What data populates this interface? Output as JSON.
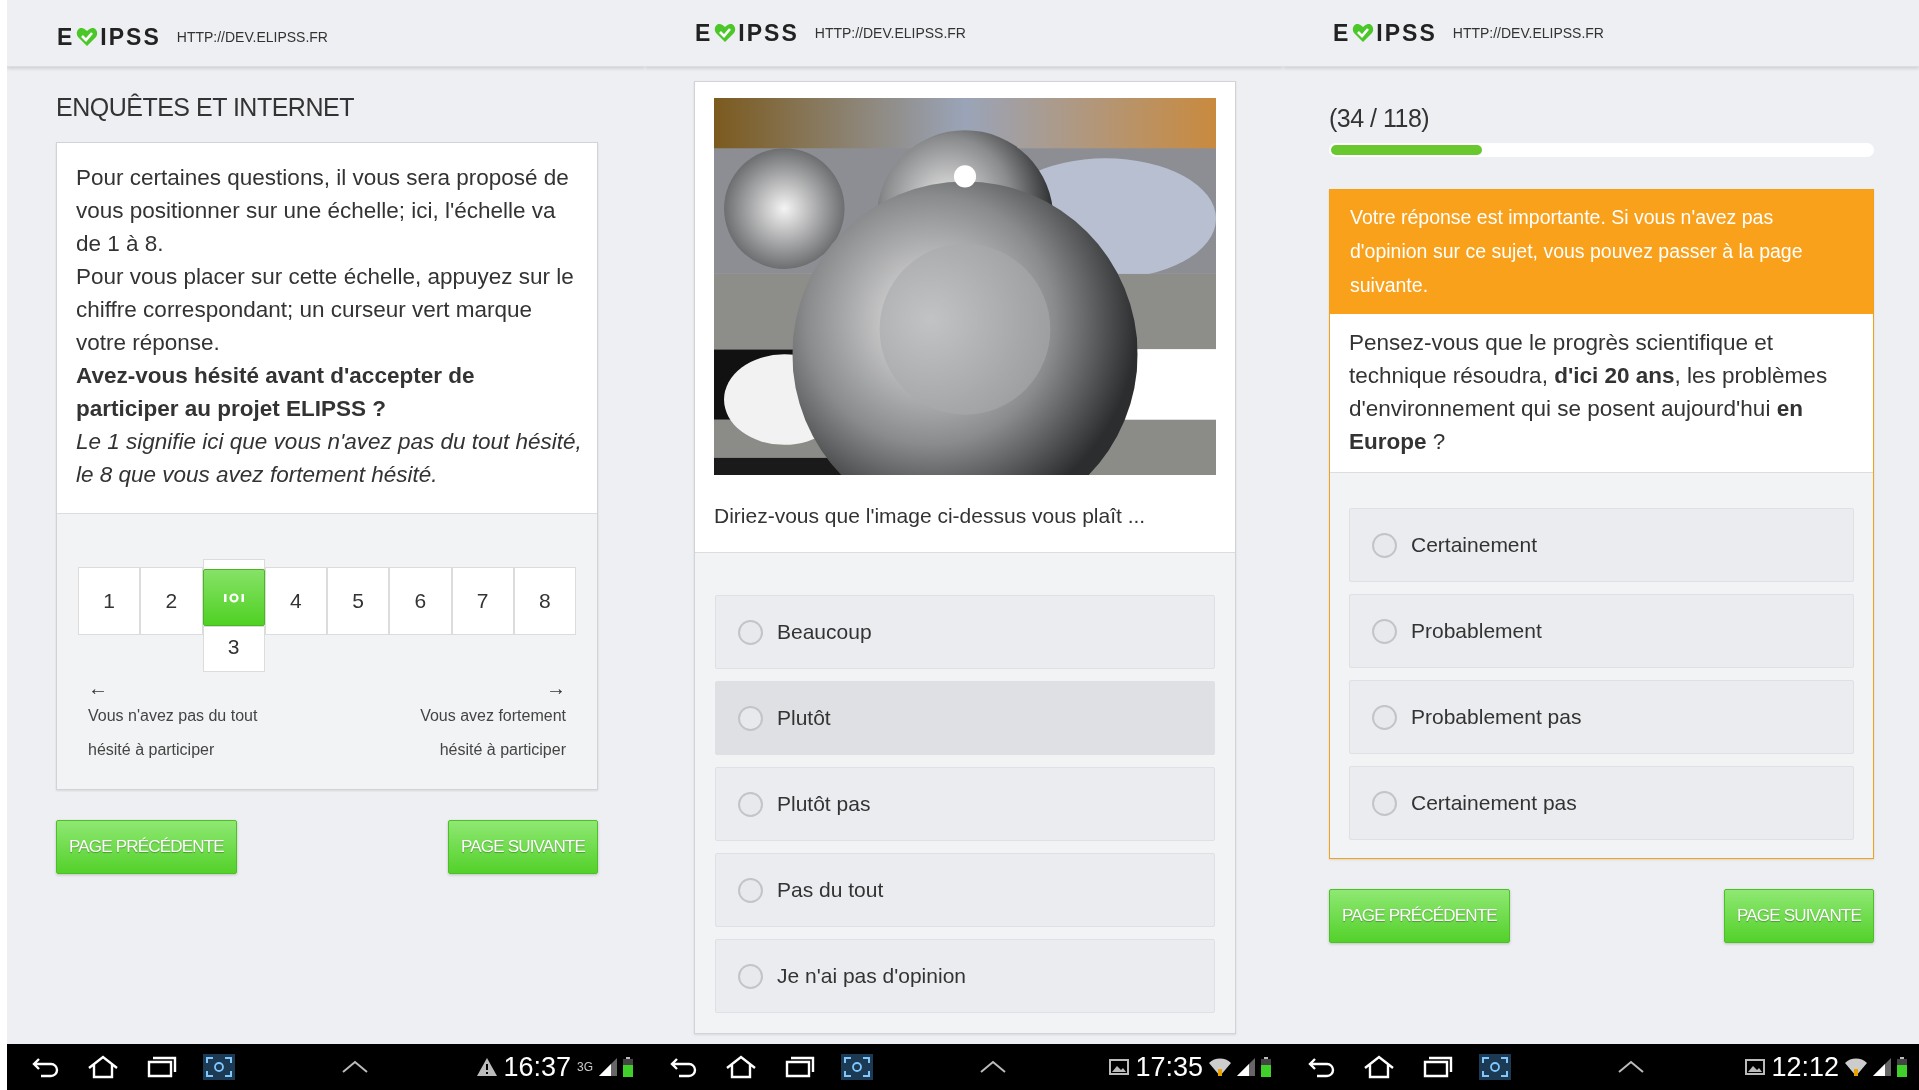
{
  "screens": [
    {
      "kind": "scale",
      "header": {
        "logo_left": "E",
        "logo_right": "IPSS",
        "url": "HTTP://DEV.ELIPSS.FR"
      },
      "title": "ENQUÊTES ET INTERNET",
      "paragraphs": [
        {
          "kind": "plain",
          "text": "Pour certaines questions, il vous sera proposé de vous positionner sur une échelle; ici, l'échelle va de 1 à 8."
        },
        {
          "kind": "plain",
          "text": "Pour vous placer sur cette échelle, appuyez sur le chiffre correspondant; un curseur vert marque votre réponse."
        },
        {
          "kind": "bold",
          "text": "Avez-vous hésité avant d'accepter de participer au projet ELIPSS ?"
        },
        {
          "kind": "italic",
          "text": "Le 1 signifie ici que vous n'avez pas du tout hésité, le 8 que vous avez fortement hésité."
        }
      ],
      "scale": {
        "steps": [
          {
            "label": "1",
            "selected": false
          },
          {
            "label": "2",
            "selected": false
          },
          {
            "label": "3",
            "selected": true
          },
          {
            "label": "4",
            "selected": false
          },
          {
            "label": "5",
            "selected": false
          },
          {
            "label": "6",
            "selected": false
          },
          {
            "label": "7",
            "selected": false
          },
          {
            "label": "8",
            "selected": false
          }
        ],
        "left_arrow": "←",
        "left_label": "Vous n'avez pas du tout hésité à participer",
        "right_arrow": "→",
        "right_label": "Vous avez fortement hésité à participer"
      },
      "buttons": [
        "PAGE PRÉCÉDENTE",
        "PAGE SUIVANTE"
      ],
      "status_bar": {
        "alert_icon": true,
        "picture_icon": false,
        "time": "16:37",
        "wifi": false,
        "network": "3G"
      }
    },
    {
      "kind": "image_question",
      "header": {
        "logo_left": "E",
        "logo_right": "IPSS",
        "url": "HTTP://DEV.ELIPSS.FR"
      },
      "question": "Diriez-vous que l'image ci-dessus vous plaît ...",
      "options": [
        {
          "label": "Beaucoup",
          "selected": false,
          "highlighted": false
        },
        {
          "label": "Plutôt",
          "selected": false,
          "highlighted": true
        },
        {
          "label": "Plutôt pas",
          "selected": false,
          "highlighted": false
        },
        {
          "label": "Pas du tout",
          "selected": false,
          "highlighted": false
        },
        {
          "label": "Je n'ai pas d'opinion",
          "selected": false,
          "highlighted": false
        }
      ],
      "status_bar": {
        "alert_icon": false,
        "picture_icon": true,
        "time": "17:35",
        "wifi": true
      }
    },
    {
      "kind": "choice_question",
      "header": {
        "logo_left": "E",
        "logo_right": "IPSS",
        "url": "HTTP://DEV.ELIPSS.FR"
      },
      "progress": {
        "text": "(34 / 118)",
        "level": 0.28
      },
      "notice": "Votre réponse est importante. Si vous n'avez pas d'opinion sur ce sujet, vous pouvez passer à la page suivante.",
      "question": "Pensez-vous que le progrès scientifique et technique résoudra, **d'ici 20 ans**, les problèmes d'environnement qui se posent aujourd'hui **en Europe** ?",
      "options": [
        {
          "label": "Certainement",
          "selected": false,
          "highlighted": false
        },
        {
          "label": "Probablement",
          "selected": false,
          "highlighted": false
        },
        {
          "label": "Probablement pas",
          "selected": false,
          "highlighted": false
        },
        {
          "label": "Certainement pas",
          "selected": false,
          "highlighted": false
        }
      ],
      "buttons": [
        "PAGE PRÉCÉDENTE",
        "PAGE SUIVANTE"
      ],
      "status_bar": {
        "alert_icon": false,
        "picture_icon": true,
        "time": "12:12",
        "wifi": true
      }
    }
  ]
}
